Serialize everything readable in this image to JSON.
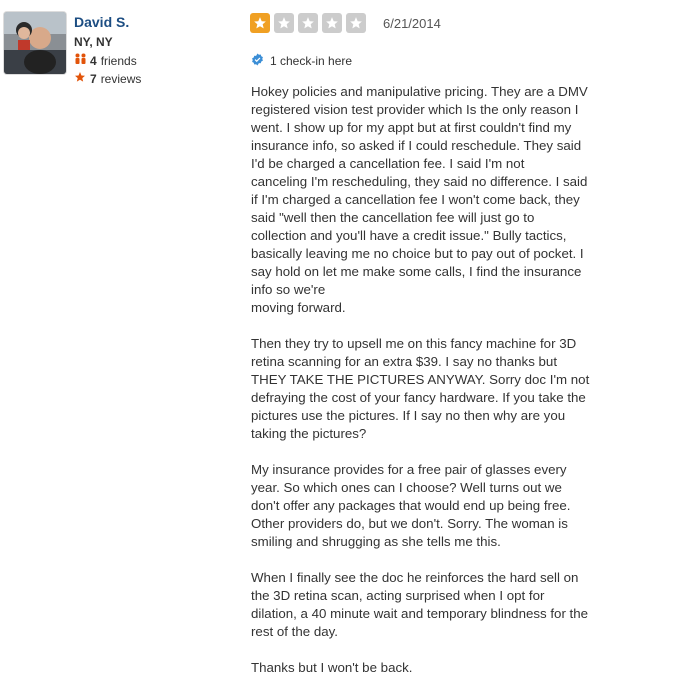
{
  "user": {
    "name": "David S.",
    "location": "NY, NY",
    "friends_count": "4",
    "friends_label": "friends",
    "reviews_count": "7",
    "reviews_label": "reviews"
  },
  "review": {
    "rating": 1,
    "max_rating": 5,
    "date": "6/21/2014",
    "checkin_text": "1 check-in here",
    "paragraphs": [
      "Hokey policies and manipulative pricing.  They are a DMV\nregistered vision test provider which Is the only reason I\nwent. I show up for my appt but at first couldn't find my\ninsurance info, so asked if I could reschedule. They said\nI'd be charged a cancellation fee.  I said I'm not\ncanceling I'm rescheduling, they said no difference. I said\nif I'm charged a cancellation fee I won't come back, they\nsaid \"well then the cancellation fee will just go to\ncollection and you'll have a credit issue.\"  Bully tactics,\nbasically leaving me no choice but to pay out of pocket.  I\nsay hold on let me make some calls, I find the insurance\ninfo so we're\nmoving forward.",
      "Then they try to upsell me on this fancy machine for 3D\nretina scanning for an extra $39. I say no thanks but\nTHEY TAKE THE PICTURES ANYWAY.  Sorry doc I'm not\ndefraying the cost of your fancy hardware.  If you take the\npictures use the pictures.  If I say no then why are you\ntaking the pictures?",
      "My insurance provides for a free pair of glasses every\nyear.  So which ones can I choose?  Well turns out we\ndon't offer any packages that would end up being free.\nOther providers do, but we don't. Sorry. The woman is\nsmiling and shrugging as she tells me this.",
      "When I finally see the doc he reinforces the hard sell on\nthe 3D retina scan, acting surprised when I opt for\ndilation, a 40 minute wait and temporary blindness for the\nrest of the day.",
      "Thanks but I won't be back."
    ]
  },
  "colors": {
    "username": "#1c4d82",
    "star_on": "#f0a023",
    "star_off": "#cccccc",
    "icon_orange": "#e2540a",
    "checkin_blue": "#3b8ed6"
  },
  "icons": {
    "friends": "friends-icon",
    "reviews": "star-icon",
    "checkin": "verified-checkin-icon"
  }
}
